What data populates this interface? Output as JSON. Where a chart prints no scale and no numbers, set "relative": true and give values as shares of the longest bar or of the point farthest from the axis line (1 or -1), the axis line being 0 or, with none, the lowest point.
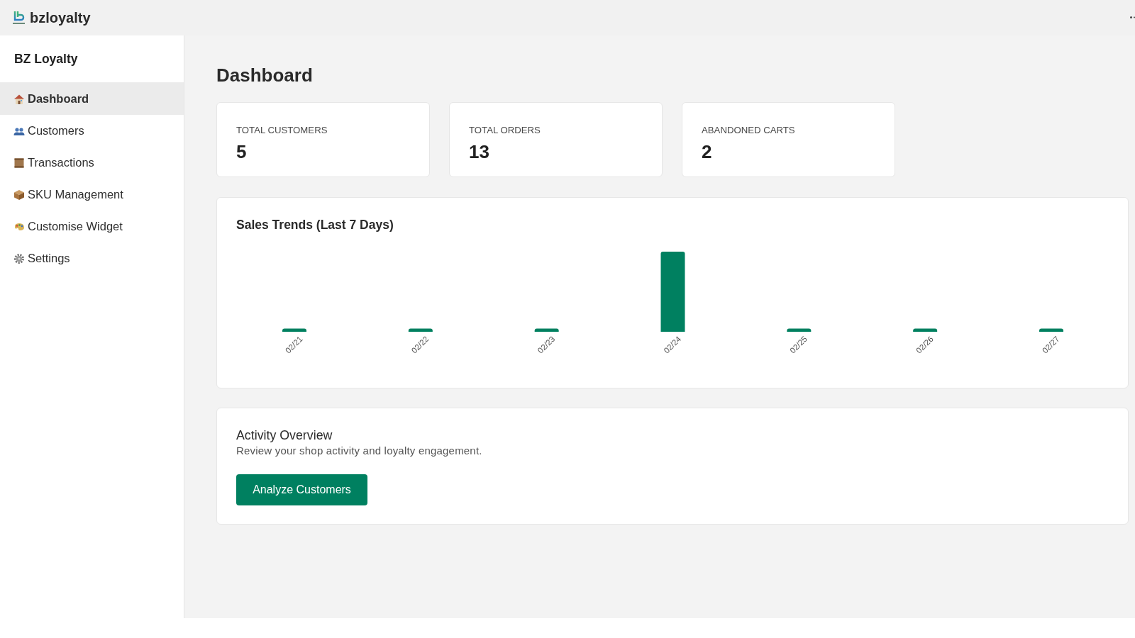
{
  "app_bar": {
    "title": "bzloyalty"
  },
  "sidebar": {
    "title": "BZ Loyalty",
    "items": [
      {
        "label": "Dashboard",
        "selected": true
      },
      {
        "label": "Customers",
        "selected": false
      },
      {
        "label": "Transactions",
        "selected": false
      },
      {
        "label": "SKU Management",
        "selected": false
      },
      {
        "label": "Customise Widget",
        "selected": false
      },
      {
        "label": "Settings",
        "selected": false
      }
    ]
  },
  "page": {
    "title": "Dashboard"
  },
  "stats": [
    {
      "label": "TOTAL CUSTOMERS",
      "value": "5"
    },
    {
      "label": "TOTAL ORDERS",
      "value": "13"
    },
    {
      "label": "ABANDONED CARTS",
      "value": "2"
    }
  ],
  "sales_card": {
    "chart_data": {
      "type": "bar",
      "title": "Sales Trends (Last 7 Days)",
      "categories": [
        "02/21",
        "02/22",
        "02/23",
        "02/24",
        "02/25",
        "02/26",
        "02/27"
      ],
      "values": [
        0.04,
        0.04,
        0.04,
        1,
        0.04,
        0.04,
        0.04
      ],
      "relative": true
    }
  },
  "activity": {
    "title": "Activity Overview",
    "description": "Review your shop activity and loyalty engagement.",
    "button": "Analyze Customers"
  }
}
